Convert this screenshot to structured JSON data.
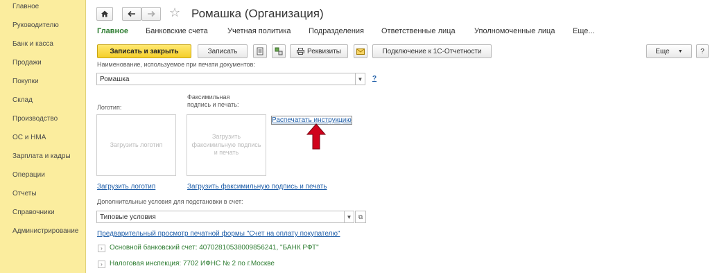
{
  "sidebar": {
    "items": [
      {
        "label": "Главное"
      },
      {
        "label": "Руководителю"
      },
      {
        "label": "Банк и касса"
      },
      {
        "label": "Продажи"
      },
      {
        "label": "Покупки"
      },
      {
        "label": "Склад"
      },
      {
        "label": "Производство"
      },
      {
        "label": "ОС и НМА"
      },
      {
        "label": "Зарплата и кадры"
      },
      {
        "label": "Операции"
      },
      {
        "label": "Отчеты"
      },
      {
        "label": "Справочники"
      },
      {
        "label": "Администрирование"
      }
    ]
  },
  "header": {
    "title": "Ромашка (Организация)",
    "home_icon": "home-icon",
    "back_icon": "arrow-left-icon",
    "forward_icon": "arrow-right-icon",
    "star_icon": "star-icon"
  },
  "tabs": [
    {
      "label": "Главное",
      "active": true
    },
    {
      "label": "Банковские счета"
    },
    {
      "label": "Учетная политика"
    },
    {
      "label": "Подразделения"
    },
    {
      "label": "Ответственные лица"
    },
    {
      "label": "Уполномоченные лица"
    },
    {
      "label": "Еще..."
    }
  ],
  "toolbar": {
    "save_close": "Записать и закрыть",
    "save": "Записать",
    "requisites": "Реквизиты",
    "connect": "Подключение к 1С-Отчетности",
    "more": "Еще",
    "help": "?"
  },
  "form": {
    "name_label": "Наименование, используемое при печати документов:",
    "name_value": "Ромашка",
    "name_help": "?",
    "logo_label": "Логотип:",
    "facsimile_label_1": "Факсимильная",
    "facsimile_label_2": "подпись и печать:",
    "logo_placeholder": "Загрузить логотип",
    "facsimile_placeholder_1": "Загрузить",
    "facsimile_placeholder_2": "факсимильную подпись",
    "facsimile_placeholder_3": "и печать",
    "print_instruction": "Распечатать инструкцию",
    "load_logo": "Загрузить логотип",
    "load_facsimile": "Загрузить факсимильную подпись и печать",
    "conditions_label": "Дополнительные условия для подстановки в счет:",
    "conditions_value": "Типовые условия",
    "preview_link": "Предварительный просмотр печатной формы \"Счет на оплату покупателю\"",
    "bank_account": "Основной банковский счет: 40702810538009856241, \"БАНК РФТ\"",
    "tax_office": "Налоговая инспекция: 7702 ИФНС № 2 по г.Москве"
  },
  "colors": {
    "sidebar_bg": "#fbed9e",
    "primary_button": "#f5cf2a",
    "active_tab": "#2e7d32",
    "link": "#1f5ea8",
    "arrow_annotation": "#d0021b"
  }
}
